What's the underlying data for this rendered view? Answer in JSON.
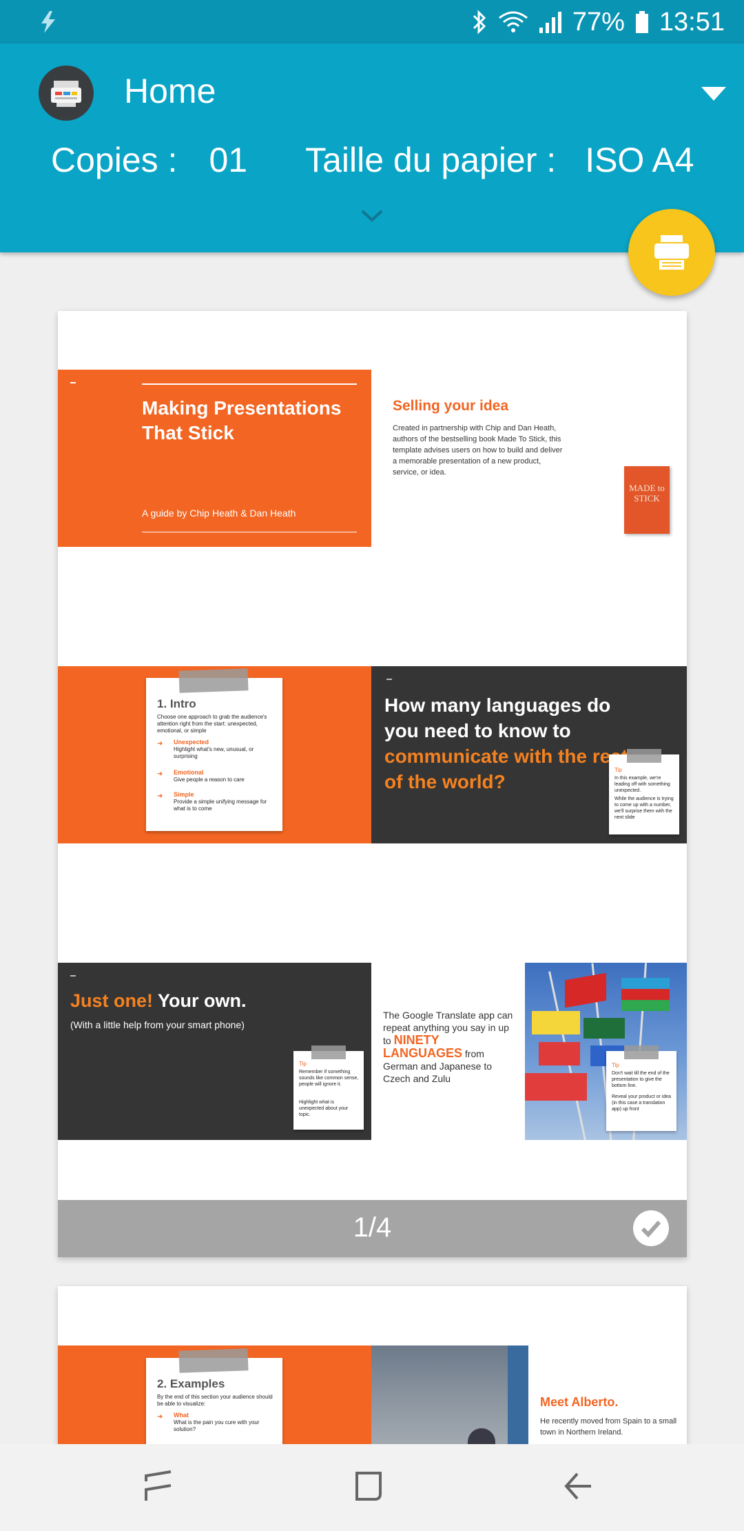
{
  "status_bar": {
    "battery": "77%",
    "time": "13:51"
  },
  "header": {
    "title": "Home",
    "copies_label": "Copies :",
    "copies_value": "01",
    "paper_label": "Taille du papier :",
    "paper_value": "ISO A4"
  },
  "preview": {
    "page_indicator": "1/4",
    "slide1": {
      "title": "Making Presentations That Stick",
      "subtitle": "A guide by Chip Heath & Dan Heath",
      "side_heading": "Selling your idea",
      "side_text": "Created in partnership with Chip and Dan Heath, authors of the bestselling book Made To Stick, this template advises users on how to build and deliver a memorable presentation of a new product, service, or idea.",
      "book_text": "MADE to STICK"
    },
    "slide2": {
      "note_title": "1. Intro",
      "note_body": "Choose one approach to grab the audience's attention right from the start: unexpected, emotional, or simple",
      "items": [
        {
          "label": "Unexpected",
          "desc": "Highlight what's new, unusual, or surprising"
        },
        {
          "label": "Emotional",
          "desc": "Give people a reason to care"
        },
        {
          "label": "Simple",
          "desc": "Provide a simple unifying message for what is to come"
        }
      ],
      "question_white": "How many languages do you need to know to",
      "question_orange": "communicate with the rest of the world?",
      "tip_label": "Tip",
      "tip_text1": "In this example, we're leading off with something unexpected.",
      "tip_text2": "While the audience is trying to come up with a number, we'll surprise them with the next slide"
    },
    "slide3": {
      "heading_orange": "Just one!",
      "heading_white": "Your own.",
      "subheading": "(With a little help from your smart phone)",
      "tip_label": "Tip",
      "tip_text1": "Remember if something sounds like common sense, people will ignore it.",
      "tip_text2": "Highlight what is unexpected about your topic.",
      "mid_text1": "The Google Translate app can repeat anything you say in up to",
      "mid_highlight": "NINETY LANGUAGES",
      "mid_text2": "from German and Japanese to Czech and Zulu",
      "flag_tip_label": "Tip",
      "flag_tip_text1": "Don't wait till the end of the presentation to give the bottom line.",
      "flag_tip_text2": "Reveal your product or idea (in this case a translation app) up front"
    },
    "slide4": {
      "note_title": "2. Examples",
      "note_body": "By the end of this section your audience should be able to visualize:",
      "item_label": "What",
      "item_desc": "What is the pain you cure with your solution?",
      "heading": "Meet Alberto.",
      "text": "He recently moved from Spain to a small town in Northern Ireland."
    }
  },
  "colors": {
    "accent": "#0aa4c6",
    "fab": "#f7c51b",
    "slide_orange": "#f26522",
    "slide_dark": "#353535"
  }
}
